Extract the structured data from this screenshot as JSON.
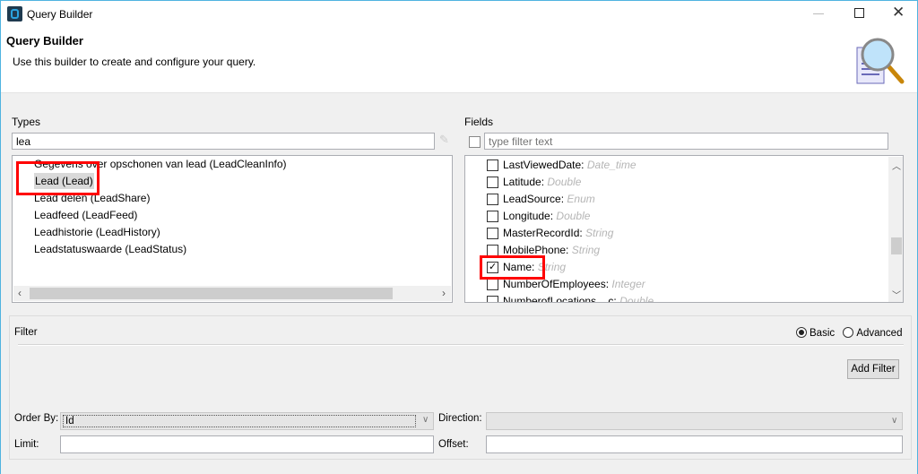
{
  "window": {
    "title": "Query Builder",
    "app_icon": "app-logo-icon",
    "controls": [
      "minimize-icon",
      "maximize-icon",
      "close-icon"
    ]
  },
  "header": {
    "title": "Query Builder",
    "subtitle": "Use this builder to create and configure your query.",
    "icon": "document-magnifier-icon"
  },
  "types": {
    "label": "Types",
    "search_value": "lea",
    "clear_icon": "eraser-icon",
    "items": [
      {
        "label": "Gegevens over opschonen van lead (LeadCleanInfo)"
      },
      {
        "label": "Lead (Lead)",
        "selected": true
      },
      {
        "label": "Lead delen (LeadShare)"
      },
      {
        "label": "Leadfeed (LeadFeed)"
      },
      {
        "label": "Leadhistorie (LeadHistory)"
      },
      {
        "label": "Leadstatuswaarde (LeadStatus)"
      }
    ]
  },
  "fields": {
    "label": "Fields",
    "filter_placeholder": "type filter text",
    "select_all_checked": false,
    "items": [
      {
        "name": "LastViewedDate:",
        "type": "Date_time",
        "checked": false
      },
      {
        "name": "Latitude:",
        "type": "Double",
        "checked": false
      },
      {
        "name": "LeadSource:",
        "type": "Enum",
        "checked": false
      },
      {
        "name": "Longitude:",
        "type": "Double",
        "checked": false
      },
      {
        "name": "MasterRecordId:",
        "type": "String",
        "checked": false
      },
      {
        "name": "MobilePhone:",
        "type": "String",
        "checked": false
      },
      {
        "name": "Name:",
        "type": "String",
        "checked": true
      },
      {
        "name": "NumberOfEmployees:",
        "type": "Integer",
        "checked": false
      },
      {
        "name": "NumberofLocations__c:",
        "type": "Double",
        "checked": false
      }
    ]
  },
  "filter": {
    "label": "Filter",
    "mode_basic": "Basic",
    "mode_advanced": "Advanced",
    "selected_mode": "Basic",
    "add_filter": "Add Filter",
    "order_by_label": "Order By:",
    "order_by_value": "Id",
    "direction_label": "Direction:",
    "direction_value": "",
    "limit_label": "Limit:",
    "limit_value": "",
    "offset_label": "Offset:",
    "offset_value": ""
  },
  "colors": {
    "highlight": "#ff0000",
    "window_border": "#4fb3e0"
  }
}
